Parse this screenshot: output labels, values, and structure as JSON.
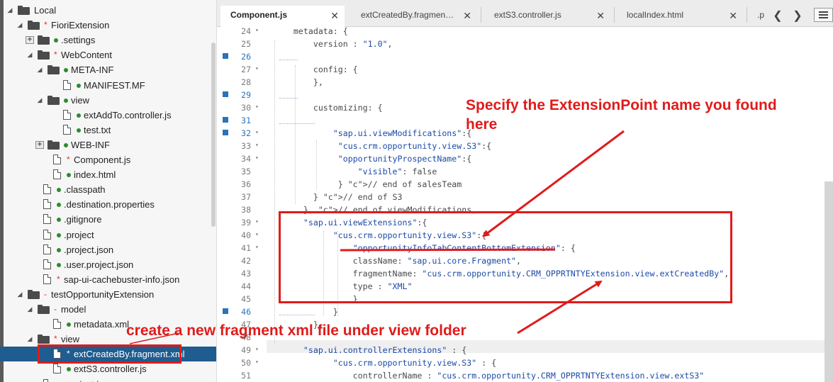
{
  "sidebar": {
    "tree": [
      {
        "id": "local",
        "label": "Local",
        "toggle": "open",
        "icon": "folder"
      },
      {
        "id": "fioriextension",
        "label": "FioriExtension",
        "toggle": "open",
        "icon": "folder",
        "star": true
      },
      {
        "id": "settings",
        "label": ".settings",
        "toggle": "plus",
        "icon": "folder",
        "dot": true
      },
      {
        "id": "webcontent",
        "label": "WebContent",
        "toggle": "open",
        "icon": "folder",
        "star": true
      },
      {
        "id": "meta-inf",
        "label": "META-INF",
        "toggle": "open",
        "icon": "folder",
        "dot": true
      },
      {
        "id": "manifest",
        "label": "MANIFEST.MF",
        "icon": "file",
        "dot": true
      },
      {
        "id": "view",
        "label": "view",
        "toggle": "open",
        "icon": "folder",
        "dot": true
      },
      {
        "id": "extaddto",
        "label": "extAddTo.controller.js",
        "icon": "file",
        "dot": true
      },
      {
        "id": "test-txt",
        "label": "test.txt",
        "icon": "file",
        "dot": true
      },
      {
        "id": "web-inf",
        "label": "WEB-INF",
        "toggle": "plus",
        "icon": "folder",
        "dot": true
      },
      {
        "id": "component-js",
        "label": "Component.js",
        "icon": "file",
        "star": true
      },
      {
        "id": "index-html",
        "label": "index.html",
        "icon": "file",
        "dot": true
      },
      {
        "id": "classpath",
        "label": ".classpath",
        "icon": "file",
        "dot": true
      },
      {
        "id": "destination",
        "label": ".destination.properties",
        "icon": "file",
        "dot": true
      },
      {
        "id": "gitignore",
        "label": ".gitignore",
        "icon": "file",
        "dot": true
      },
      {
        "id": "project",
        "label": ".project",
        "icon": "file",
        "dot": true
      },
      {
        "id": "project-json",
        "label": ".project.json",
        "icon": "file",
        "dot": true
      },
      {
        "id": "user-project-json",
        "label": ".user.project.json",
        "icon": "file",
        "dot": true
      },
      {
        "id": "cachebuster",
        "label": "sap-ui-cachebuster-info.json",
        "icon": "file",
        "star": true
      },
      {
        "id": "testopp",
        "label": "testOpportunityExtension",
        "toggle": "open",
        "icon": "folder",
        "dash": true
      },
      {
        "id": "model",
        "label": "model",
        "toggle": "open",
        "icon": "folder",
        "dash": true
      },
      {
        "id": "metadata-xml",
        "label": "metadata.xml",
        "icon": "file",
        "dot": true
      },
      {
        "id": "view2",
        "label": "view",
        "toggle": "open",
        "icon": "folder",
        "star": true
      },
      {
        "id": "extcreatedby",
        "label": "extCreatedBy.fragment.xml",
        "icon": "file",
        "star": true,
        "selected": true
      },
      {
        "id": "exts3",
        "label": "extS3.controller.js",
        "icon": "file",
        "dot": true
      },
      {
        "id": "project-json2",
        "label": ".project.json",
        "icon": "file",
        "dot": true
      }
    ]
  },
  "tabs": [
    {
      "label": "Component.js",
      "active": true,
      "close": "✕"
    },
    {
      "label": "extCreatedBy.fragmen…",
      "close": "✕"
    },
    {
      "label": "extS3.controller.js",
      "close": "✕"
    },
    {
      "label": "localIndex.html",
      "close": "✕"
    },
    {
      "label": ".p"
    }
  ],
  "tab_nav": {
    "prev": "❮",
    "next": "❯"
  },
  "code": [
    {
      "n": "24",
      "fold": true,
      "t": "    metadata: {"
    },
    {
      "n": "25",
      "t": "        version : \"1.0\","
    },
    {
      "n": "26",
      "mark": true,
      "t": ""
    },
    {
      "n": "27",
      "fold": true,
      "t": "        config: {"
    },
    {
      "n": "28",
      "t": "        },"
    },
    {
      "n": "29",
      "mark": true,
      "t": ""
    },
    {
      "n": "30",
      "fold": true,
      "t": "        customizing: {"
    },
    {
      "n": "31",
      "mark": true,
      "t": ""
    },
    {
      "n": "32",
      "fold": true,
      "mark": true,
      "t": "            \"sap.ui.viewModifications\":{"
    },
    {
      "n": "33",
      "fold": true,
      "t": "             \"cus.crm.opportunity.view.S3\":{"
    },
    {
      "n": "34",
      "fold": true,
      "t": "             \"opportunityProspectName\":{"
    },
    {
      "n": "35",
      "t": "                 \"visible\": false"
    },
    {
      "n": "36",
      "t": "             } // end of salesTeam"
    },
    {
      "n": "37",
      "t": "        } // end of S3"
    },
    {
      "n": "38",
      "t": "      }, // end of viewModifications,"
    },
    {
      "n": "39",
      "fold": true,
      "t": "      \"sap.ui.viewExtensions\":{"
    },
    {
      "n": "40",
      "fold": true,
      "t": "            \"cus.crm.opportunity.view.S3\":{"
    },
    {
      "n": "41",
      "fold": true,
      "t": "                \"opportunityInfoTabContentBottomExtension\": {"
    },
    {
      "n": "42",
      "t": "                className: \"sap.ui.core.Fragment\","
    },
    {
      "n": "43",
      "t": "                fragmentName: \"cus.crm.opportunity.CRM_OPPRTNTYExtension.view.extCreatedBy\","
    },
    {
      "n": "44",
      "t": "                type : \"XML\""
    },
    {
      "n": "45",
      "t": "                }"
    },
    {
      "n": "46",
      "mark": true,
      "t": "            }"
    },
    {
      "n": "47",
      "t": "        },"
    },
    {
      "n": "48",
      "t": ""
    },
    {
      "n": "49",
      "fold": true,
      "t": "      \"sap.ui.controllerExtensions\" : {"
    },
    {
      "n": "50",
      "fold": true,
      "t": "            \"cus.crm.opportunity.view.S3\" : {"
    },
    {
      "n": "51",
      "t": "                controllerName : \"cus.crm.opportunity.CRM_OPPRTNTYExtension.view.extS3\""
    }
  ],
  "annotations": {
    "top_text": "Specify the ExtensionPoint name you found here",
    "top_line1": "Specify the ExtensionPoint name you found",
    "top_line2": "here",
    "bottom_text": "create a new fragment xml file under view folder",
    "color": "#e01b1b"
  },
  "colors": {
    "selection": "#1f5c8f",
    "string": "#1c4aa8",
    "marker": "#2a73b8"
  }
}
